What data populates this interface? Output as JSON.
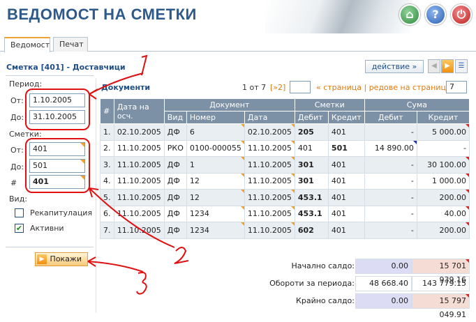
{
  "header": {
    "title": "ВЕДОМОСТ НА СМЕТКИ"
  },
  "tabs": [
    {
      "label": "Ведомост"
    },
    {
      "label": "Печат"
    }
  ],
  "panel_title": "Сметка [401] - Доставчици",
  "period": {
    "label": "Период:",
    "from_label": "От:",
    "from": "1.10.2005",
    "to_label": "До:",
    "to": "31.10.2005"
  },
  "accounts": {
    "label": "Сметки:",
    "from_label": "От:",
    "from": "401",
    "to_label": "До:",
    "to": "501",
    "num_label": "#",
    "num": "401"
  },
  "view": {
    "label": "Вид:",
    "recap": "Рекапитулация",
    "active": "Активни"
  },
  "show_button": "Покажи",
  "action_button": "действие »",
  "docs_title": "Документи",
  "pager": {
    "info": "1 от 7",
    "next": "[»2]",
    "page_text": "« страница | редове на страница »",
    "rows": "7"
  },
  "columns": {
    "num": "#",
    "date": "Дата на осч.",
    "document": "Документ",
    "accounts": "Сметки",
    "sum": "Сума",
    "type": "Вид",
    "number": "Номер",
    "doc_date": "Дата",
    "debit": "Дебит",
    "credit": "Кредит"
  },
  "rows": [
    {
      "n": "1.",
      "date": "02.10.2005",
      "type": "ДФ",
      "number": "6",
      "doc_date": "02.10.2005",
      "acc_d": "205",
      "acc_c": "401",
      "sum_d": "-",
      "sum_c": "5 000.00"
    },
    {
      "n": "2.",
      "date": "11.10.2005",
      "type": "РКО",
      "number": "0100-000055",
      "doc_date": "11.10.2005",
      "acc_d": "401",
      "acc_c": "501",
      "sum_d": "14 890.00",
      "sum_c": "-"
    },
    {
      "n": "3.",
      "date": "11.10.2005",
      "type": "ДФ",
      "number": "1",
      "doc_date": "11.10.2005",
      "acc_d": "301",
      "acc_c": "401",
      "sum_d": "-",
      "sum_c": "30 100.00"
    },
    {
      "n": "4.",
      "date": "11.10.2005",
      "type": "ДФ",
      "number": "12",
      "doc_date": "11.10.2005",
      "acc_d": "301",
      "acc_c": "401",
      "sum_d": "-",
      "sum_c": "1 000.00"
    },
    {
      "n": "5.",
      "date": "11.10.2005",
      "type": "ДФ",
      "number": "12",
      "doc_date": "11.10.2005",
      "acc_d": "453.1",
      "acc_c": "401",
      "sum_d": "-",
      "sum_c": "200.00"
    },
    {
      "n": "6.",
      "date": "11.10.2005",
      "type": "ДФ",
      "number": "1234",
      "doc_date": "11.10.2005",
      "acc_d": "453.1",
      "acc_c": "401",
      "sum_d": "-",
      "sum_c": "40.00"
    },
    {
      "n": "7.",
      "date": "11.10.2005",
      "type": "ДФ",
      "number": "1234",
      "doc_date": "11.10.2005",
      "acc_d": "602",
      "acc_c": "401",
      "sum_d": "-",
      "sum_c": "200.00"
    }
  ],
  "totals": [
    {
      "label": "Начално салдо:",
      "debit": "0.00",
      "credit": "15 701 939.16"
    },
    {
      "label": "Обороти за периода:",
      "debit": "48 668.40",
      "credit": "143 779.15"
    },
    {
      "label": "Крайно салдо:",
      "debit": "0.00",
      "credit": "15 797 049.91"
    }
  ],
  "annotations": {
    "a1": "1",
    "a2": "2",
    "a3": "3"
  }
}
